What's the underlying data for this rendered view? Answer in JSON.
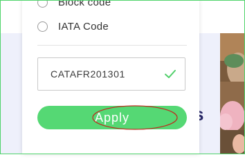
{
  "options": [
    {
      "label": "Block code"
    },
    {
      "label": "IATA Code"
    }
  ],
  "code_input": {
    "value": "CATAFR201301",
    "status_icon": "check-icon"
  },
  "apply_button": {
    "label": "Apply"
  },
  "background": {
    "visible_text": "s"
  },
  "colors": {
    "accent": "#55d874",
    "check": "#4fcf69",
    "annotation": "#c0281e",
    "text": "#333333"
  }
}
